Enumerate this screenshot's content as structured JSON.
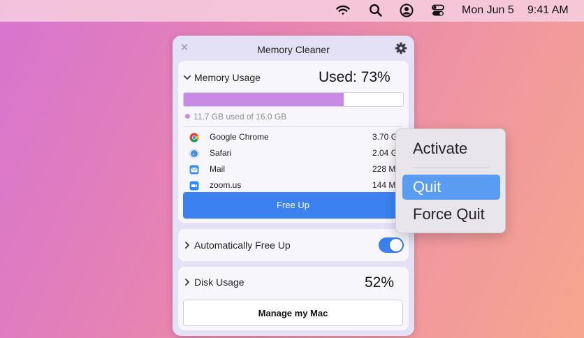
{
  "menubar": {
    "date": "Mon Jun 5",
    "time": "9:41 AM",
    "icons": [
      "wifi-icon",
      "search-icon",
      "user-account-icon",
      "control-center-icon"
    ]
  },
  "panel": {
    "title": "Memory Cleaner",
    "close_icon": "close-icon",
    "settings_icon": "gear-icon",
    "memory": {
      "label": "Memory Usage",
      "used_text": "Used: 73%",
      "used_fraction": 0.73,
      "bar_color": "#c98ae6",
      "legend": "11.7 GB used of 16.0 GB",
      "apps": [
        {
          "name": "Google Chrome",
          "size": "3.70 GB",
          "icon": "chrome-icon"
        },
        {
          "name": "Safari",
          "size": "2.04 GB",
          "icon": "safari-icon"
        },
        {
          "name": "Mail",
          "size": "228 MB",
          "icon": "mail-icon"
        },
        {
          "name": "zoom.us",
          "size": "144 MB",
          "icon": "zoom-icon"
        }
      ],
      "free_up_label": "Free Up"
    },
    "auto_free": {
      "label": "Automatically Free Up",
      "enabled": true
    },
    "disk": {
      "label": "Disk Usage",
      "value": "52%",
      "manage_label": "Manage my Mac"
    }
  },
  "context_menu": {
    "items": [
      "Activate",
      "Quit",
      "Force Quit"
    ],
    "highlighted": "Quit"
  },
  "colors": {
    "accent": "#3b82f0",
    "highlight": "#5a9cf2",
    "panel_bg": "#e4e0f6"
  }
}
